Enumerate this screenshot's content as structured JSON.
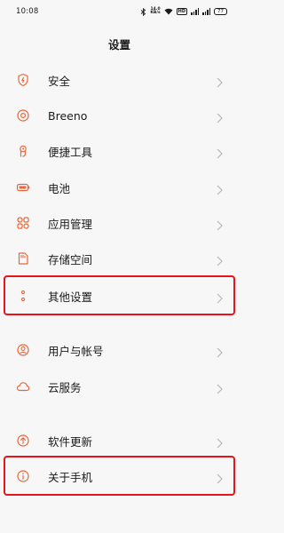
{
  "status_bar": {
    "time": "10:08",
    "speed_value": "14.0",
    "speed_unit": "KB/s",
    "hd_label": "HD",
    "battery": "77"
  },
  "page": {
    "title": "设置"
  },
  "menu": [
    {
      "label": "安全",
      "icon": "shield-icon"
    },
    {
      "label": "Breeno",
      "icon": "breeno-icon"
    },
    {
      "label": "便捷工具",
      "icon": "hand-tool-icon"
    },
    {
      "label": "电池",
      "icon": "battery-icon"
    },
    {
      "label": "应用管理",
      "icon": "apps-grid-icon"
    },
    {
      "label": "存储空间",
      "icon": "storage-icon"
    },
    {
      "label": "其他设置",
      "icon": "more-dots-icon"
    },
    {
      "label": "用户与帐号",
      "icon": "user-icon"
    },
    {
      "label": "云服务",
      "icon": "cloud-icon"
    },
    {
      "label": "软件更新",
      "icon": "update-icon"
    },
    {
      "label": "关于手机",
      "icon": "info-icon"
    }
  ],
  "colors": {
    "accent_icon": "#e9663c",
    "highlight_border": "#e8141c",
    "background": "#f7f7f7",
    "chevron": "#b4b4b4"
  }
}
